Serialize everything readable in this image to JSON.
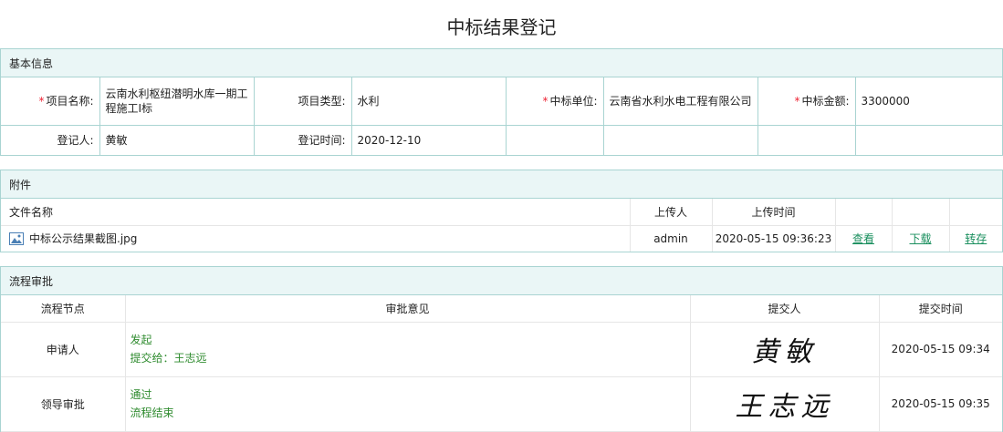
{
  "title": "中标结果登记",
  "basic": {
    "header": "基本信息",
    "project_name_label": "项目名称:",
    "project_name": "云南水利枢纽潜明水库一期工程施工I标",
    "project_type_label": "项目类型:",
    "project_type": "水利",
    "winner_label": "中标单位:",
    "winner": "云南省水利水电工程有限公司",
    "amount_label": "中标金额:",
    "amount": "3300000",
    "registrant_label": "登记人:",
    "registrant": "黄敏",
    "reg_time_label": "登记时间:",
    "reg_time": "2020-12-10",
    "required_mark": "*"
  },
  "attachments": {
    "header": "附件",
    "col_name": "文件名称",
    "col_uploader": "上传人",
    "col_time": "上传时间",
    "files": [
      {
        "name": "中标公示结果截图.jpg",
        "uploader": "admin",
        "time": "2020-05-15 09:36:23",
        "view": "查看",
        "download": "下载",
        "transfer": "转存",
        "icon": "image-file-icon"
      }
    ]
  },
  "flow": {
    "header": "流程审批",
    "col_node": "流程节点",
    "col_opinion": "审批意见",
    "col_submitter": "提交人",
    "col_time": "提交时间",
    "rows": [
      {
        "node": "申请人",
        "line1": "发起",
        "line2": "提交给：王志远",
        "signature": "黄敏",
        "time": "2020-05-15 09:34"
      },
      {
        "node": "领导审批",
        "line1": "通过",
        "line2": "流程结束",
        "signature": "王志远",
        "time": "2020-05-15 09:35"
      }
    ]
  }
}
